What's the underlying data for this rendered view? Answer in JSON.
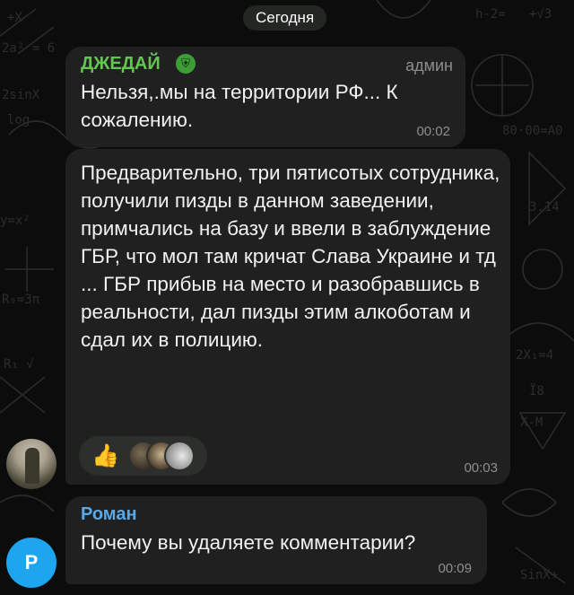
{
  "date_separator": "Сегодня",
  "messages": [
    {
      "author": "ДЖЕДАЙ",
      "role": "админ",
      "text": "Нельзя,.мы на территории РФ... К сожалению.",
      "time": "00:02",
      "author_color": "#63c64f"
    },
    {
      "text": "Предварительно, три пятисотых сотрудника, получили пизды в данном заведении, примчались на базу и ввели в заблуждение ГБР, что мол там кричат Слава Украине и тд ... ГБР прибыв на место и разобравшись в реальности, дал пизды этим алкоботам и сдал их в полицию.",
      "time": "00:03",
      "reaction_emoji": "👍"
    },
    {
      "author": "Роман",
      "avatar_letter": "Р",
      "text": "Почему вы удаляете комментарии?",
      "time": "00:09",
      "author_color": "#5aa8e6",
      "avatar_color": "#1da5f0"
    }
  ],
  "bubble_color": "#1f201f",
  "background_color": "#0b0c0b"
}
